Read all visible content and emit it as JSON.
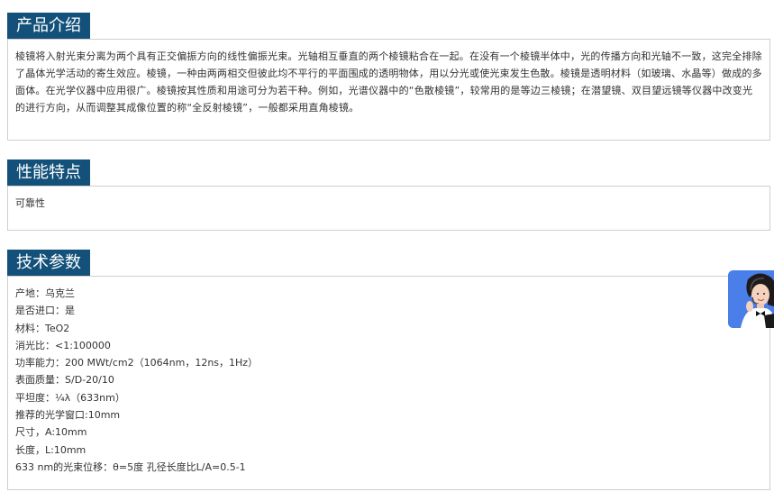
{
  "sections": {
    "intro": {
      "title": "产品介绍",
      "text": "棱镜将入射光束分离为两个具有正交偏振方向的线性偏振光束。光轴相互垂直的两个棱镜粘合在一起。在没有一个棱镜半体中，光的传播方向和光轴不一致，这完全排除了晶体光学活动的寄生效应。棱镜，一种由两两相交但彼此均不平行的平面围成的透明物体，用以分光或使光束发生色散。棱镜是透明材料（如玻璃、水晶等）做成的多面体。在光学仪器中应用很广。棱镜按其性质和用途可分为若干种。例如，光谱仪器中的“色散棱镜”，较常用的是等边三棱镜；在潜望镜、双目望远镜等仪器中改变光的进行方向，从而调整其成像位置的称“全反射棱镜”，一般都采用直角棱镜。"
    },
    "features": {
      "title": "性能特点",
      "text": "可靠性"
    },
    "specs": {
      "title": "技术参数",
      "items": [
        "产地：乌克兰",
        "是否进口：是",
        "材料：TeO2",
        "消光比：<1:100000",
        "功率能力：200 MWt/cm2（1064nm，12ns，1Hz）",
        "表面质量：S/D-20/10",
        "平坦度：¼λ（633nm）",
        "推荐的光学窗口:10mm",
        "尺寸，A:10mm",
        "长度，L:10mm",
        "633 nm的光束位移：θ=5度 孔径长度比L/A=0.5-1"
      ]
    }
  },
  "colors": {
    "tab_background": "#13517a",
    "tab_text": "#ffffff",
    "border": "#cfcfcf",
    "body_text": "#333333",
    "support_badge": "#4a7ee8"
  },
  "icons": {
    "support": "customer-service-agent-icon"
  }
}
